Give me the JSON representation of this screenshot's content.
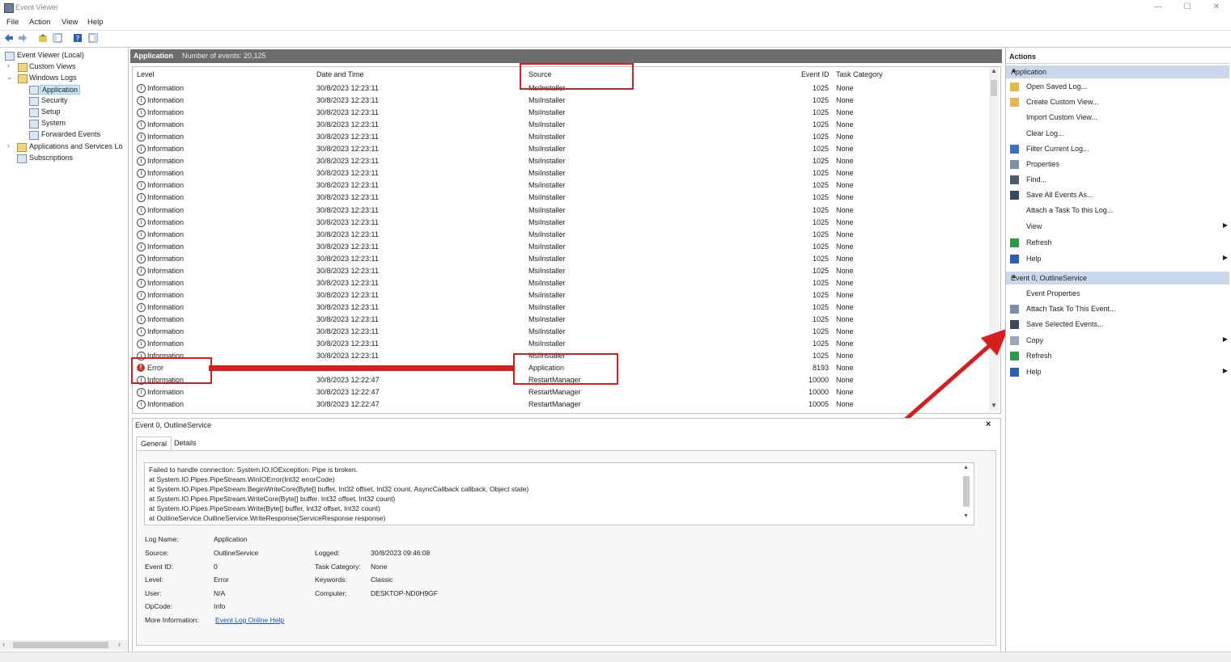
{
  "window": {
    "title": "Event Viewer",
    "minimize": "—",
    "maximize": "☐",
    "close": "✕"
  },
  "menu": [
    "File",
    "Action",
    "View",
    "Help"
  ],
  "tree": {
    "root": "Event Viewer (Local)",
    "custom_views": "Custom Views",
    "windows_logs": "Windows Logs",
    "application": "Application",
    "security": "Security",
    "setup": "Setup",
    "system": "System",
    "forwarded": "Forwarded Events",
    "apps_services": "Applications and Services Lo",
    "subscriptions": "Subscriptions"
  },
  "center": {
    "title": "Application",
    "count_label": "Number of events: 20,125"
  },
  "columns": {
    "level": "Level",
    "datetime": "Date and Time",
    "source": "Source",
    "event_id": "Event ID",
    "task": "Task Category"
  },
  "events": [
    {
      "level": "Information",
      "datetime": "30/8/2023 12:23:11",
      "source": "MsiInstaller",
      "id": "1025",
      "task": "None"
    },
    {
      "level": "Information",
      "datetime": "30/8/2023 12:23:11",
      "source": "MsiInstaller",
      "id": "1025",
      "task": "None"
    },
    {
      "level": "Information",
      "datetime": "30/8/2023 12:23:11",
      "source": "MsiInstaller",
      "id": "1025",
      "task": "None"
    },
    {
      "level": "Information",
      "datetime": "30/8/2023 12:23:11",
      "source": "MsiInstaller",
      "id": "1025",
      "task": "None"
    },
    {
      "level": "Information",
      "datetime": "30/8/2023 12:23:11",
      "source": "MsiInstaller",
      "id": "1025",
      "task": "None"
    },
    {
      "level": "Information",
      "datetime": "30/8/2023 12:23:11",
      "source": "MsiInstaller",
      "id": "1025",
      "task": "None"
    },
    {
      "level": "Information",
      "datetime": "30/8/2023 12:23:11",
      "source": "MsiInstaller",
      "id": "1025",
      "task": "None"
    },
    {
      "level": "Information",
      "datetime": "30/8/2023 12:23:11",
      "source": "MsiInstaller",
      "id": "1025",
      "task": "None"
    },
    {
      "level": "Information",
      "datetime": "30/8/2023 12:23:11",
      "source": "MsiInstaller",
      "id": "1025",
      "task": "None"
    },
    {
      "level": "Information",
      "datetime": "30/8/2023 12:23:11",
      "source": "MsiInstaller",
      "id": "1025",
      "task": "None"
    },
    {
      "level": "Information",
      "datetime": "30/8/2023 12:23:11",
      "source": "MsiInstaller",
      "id": "1025",
      "task": "None"
    },
    {
      "level": "Information",
      "datetime": "30/8/2023 12:23:11",
      "source": "MsiInstaller",
      "id": "1025",
      "task": "None"
    },
    {
      "level": "Information",
      "datetime": "30/8/2023 12:23:11",
      "source": "MsiInstaller",
      "id": "1025",
      "task": "None"
    },
    {
      "level": "Information",
      "datetime": "30/8/2023 12:23:11",
      "source": "MsiInstaller",
      "id": "1025",
      "task": "None"
    },
    {
      "level": "Information",
      "datetime": "30/8/2023 12:23:11",
      "source": "MsiInstaller",
      "id": "1025",
      "task": "None"
    },
    {
      "level": "Information",
      "datetime": "30/8/2023 12:23:11",
      "source": "MsiInstaller",
      "id": "1025",
      "task": "None"
    },
    {
      "level": "Information",
      "datetime": "30/8/2023 12:23:11",
      "source": "MsiInstaller",
      "id": "1025",
      "task": "None"
    },
    {
      "level": "Information",
      "datetime": "30/8/2023 12:23:11",
      "source": "MsiInstaller",
      "id": "1025",
      "task": "None"
    },
    {
      "level": "Information",
      "datetime": "30/8/2023 12:23:11",
      "source": "MsiInstaller",
      "id": "1025",
      "task": "None"
    },
    {
      "level": "Information",
      "datetime": "30/8/2023 12:23:11",
      "source": "MsiInstaller",
      "id": "1025",
      "task": "None"
    },
    {
      "level": "Information",
      "datetime": "30/8/2023 12:23:11",
      "source": "MsiInstaller",
      "id": "1025",
      "task": "None"
    },
    {
      "level": "Information",
      "datetime": "30/8/2023 12:23:11",
      "source": "MsiInstaller",
      "id": "1025",
      "task": "None"
    },
    {
      "level": "Information",
      "datetime": "30/8/2023 12:23:11",
      "source": "MsiInstaller",
      "id": "1025",
      "task": "None"
    },
    {
      "level": "Error",
      "datetime": "",
      "source": "Application",
      "id": "8193",
      "task": "None"
    },
    {
      "level": "Information",
      "datetime": "30/8/2023 12:22:47",
      "source": "RestartManager",
      "id": "10000",
      "task": "None"
    },
    {
      "level": "Information",
      "datetime": "30/8/2023 12:22:47",
      "source": "RestartManager",
      "id": "10000",
      "task": "None"
    },
    {
      "level": "Information",
      "datetime": "30/8/2023 12:22:47",
      "source": "RestartManager",
      "id": "10005",
      "task": "None"
    }
  ],
  "detail": {
    "title": "Event 0, OutlineService",
    "close": "×",
    "tab_general": "General",
    "tab_details": "Details",
    "message": [
      "Failed to handle connection: System.IO.IOException: Pipe is broken.",
      "   at System.IO.Pipes.PipeStream.WinIOError(Int32 errorCode)",
      "   at System.IO.Pipes.PipeStream.BeginWriteCore(Byte[] buffer, Int32 offset, Int32 count, AsyncCallback callback, Object state)",
      "   at System.IO.Pipes.PipeStream.WriteCore(Byte[] buffer, Int32 offset, Int32 count)",
      "   at System.IO.Pipes.PipeStream.Write(Byte[] buffer, Int32 offset, Int32 count)",
      "   at OutlineService.OutlineService.WriteResponse(ServiceResponse response)"
    ],
    "labels": {
      "log_name": "Log Name:",
      "source": "Source:",
      "event_id": "Event ID:",
      "level": "Level:",
      "user": "User:",
      "opcode": "OpCode:",
      "more_info": "More Information:",
      "logged": "Logged:",
      "task_category": "Task Category:",
      "keywords": "Keywords:",
      "computer": "Computer:"
    },
    "values": {
      "log_name": "Application",
      "source": "OutlineService",
      "event_id": "0",
      "level": "Error",
      "user": "N/A",
      "opcode": "Info",
      "more_info": "Event Log Online Help",
      "logged": "30/8/2023 09:46:08",
      "task_category": "None",
      "keywords": "Classic",
      "computer": "DESKTOP-ND0H9GF"
    }
  },
  "actions": {
    "title": "Actions",
    "section1": "Application",
    "items1": [
      "Open Saved Log...",
      "Create Custom View...",
      "Import Custom View...",
      "Clear Log...",
      "Filter Current Log...",
      "Properties",
      "Find...",
      "Save All Events As...",
      "Attach a Task To this Log...",
      "View",
      "Refresh",
      "Help"
    ],
    "section2": "Event 0, OutlineService",
    "items2": [
      "Event Properties",
      "Attach Task To This Event...",
      "Save Selected Events...",
      "Copy",
      "Refresh",
      "Help"
    ]
  },
  "colors": {
    "accent_header": "#6d6d6d",
    "section_bg": "#c8d8ea",
    "highlight": "#d81f1f",
    "error": "#c0392b",
    "link": "#1a4fd6"
  }
}
